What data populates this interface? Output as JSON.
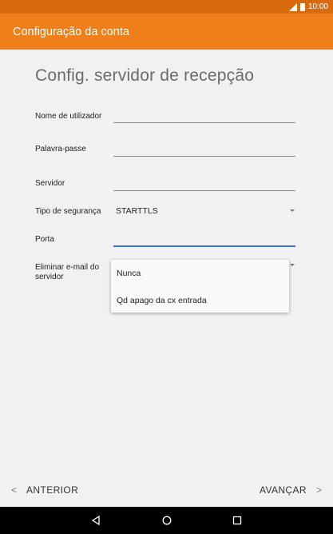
{
  "status_bar": {
    "time": "10:00",
    "icons": [
      "signal-icon",
      "battery-icon"
    ]
  },
  "app_bar": {
    "title": "Configuração da conta"
  },
  "page": {
    "heading": "Config. servidor de recepção"
  },
  "form": {
    "username_label": "Nome de utilizador",
    "password_label": "Palavra-passe",
    "server_label": "Servidor",
    "security_label": "Tipo de segurança",
    "security_value": "STARTTLS",
    "port_label": "Porta",
    "delete_label_line1": "Eliminar e-mail do",
    "delete_label_line2": "servidor"
  },
  "delete_menu": {
    "options": [
      "Nunca",
      "Qd apago da cx entrada"
    ]
  },
  "footer": {
    "prev_label": "ANTERIOR",
    "next_label": "AVANÇAR"
  },
  "colors": {
    "status_bar": "#d86b0e",
    "app_bar": "#ef7f1a",
    "focus": "#3b6fd4"
  }
}
